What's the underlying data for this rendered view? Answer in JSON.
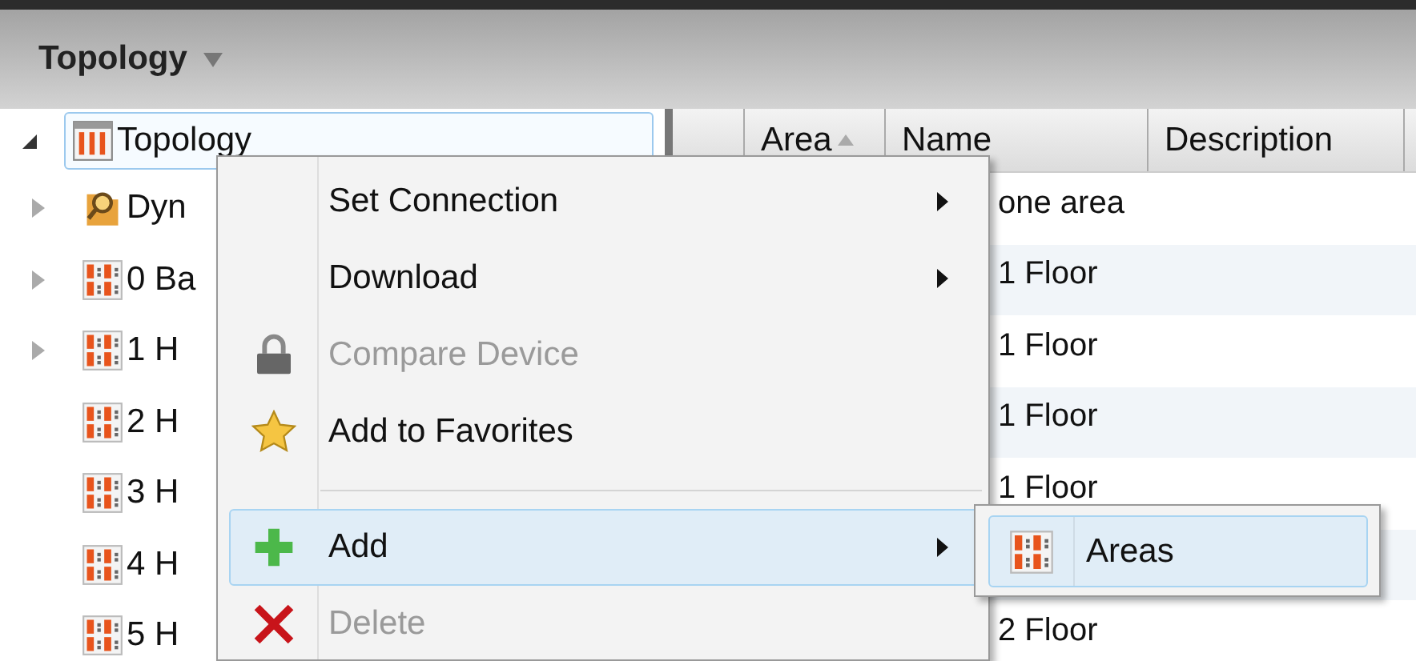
{
  "header": {
    "title": "Topology"
  },
  "tree": {
    "items": [
      {
        "label": "Topology",
        "kind": "topology",
        "expanded": true,
        "selected": true,
        "children": [
          {
            "label": "Dyn",
            "kind": "search-folder",
            "expanded": false,
            "selected": false
          },
          {
            "label": "0 Ba",
            "kind": "area",
            "expanded": false,
            "selected": false
          },
          {
            "label": "1 H",
            "kind": "area",
            "expanded": false,
            "selected": false
          },
          {
            "label": "2 H",
            "kind": "area",
            "selected": false
          },
          {
            "label": "3 H",
            "kind": "area",
            "selected": false
          },
          {
            "label": "4 H",
            "kind": "area",
            "selected": false
          },
          {
            "label": "5 H",
            "kind": "area",
            "selected": false
          }
        ]
      }
    ]
  },
  "table": {
    "columns": [
      {
        "sorted": false
      },
      {
        "label": "Area",
        "sorted": true
      },
      {
        "label": "Name",
        "sorted": false
      },
      {
        "label": "Description",
        "sorted": false
      }
    ],
    "rows": [
      {
        "name": "one area"
      },
      {
        "name": "1 Floor"
      },
      {
        "name": "1 Floor"
      },
      {
        "name": "1 Floor"
      },
      {
        "name": "1 Floor"
      },
      {},
      {
        "name": "2 Floor"
      }
    ]
  },
  "context_menu": {
    "items": [
      {
        "kind": "plain",
        "label": "Set Connection",
        "disabled": false,
        "selected": false,
        "submenu": true
      },
      {
        "kind": "plain",
        "label": "Download",
        "disabled": false,
        "selected": false,
        "submenu": true
      },
      {
        "kind": "lock",
        "label": "Compare Device",
        "disabled": true,
        "selected": false,
        "submenu": false
      },
      {
        "kind": "star",
        "label": "Add to Favorites",
        "disabled": false,
        "selected": false,
        "submenu": false
      },
      {
        "kind": "separator"
      },
      {
        "kind": "plus",
        "label": "Add",
        "disabled": false,
        "selected": true,
        "submenu": true
      },
      {
        "kind": "cross",
        "label": "Delete",
        "disabled": true,
        "selected": false,
        "submenu": false
      }
    ]
  },
  "submenu": {
    "items": [
      {
        "label": "Areas",
        "kind": "area",
        "selected": true
      }
    ]
  }
}
